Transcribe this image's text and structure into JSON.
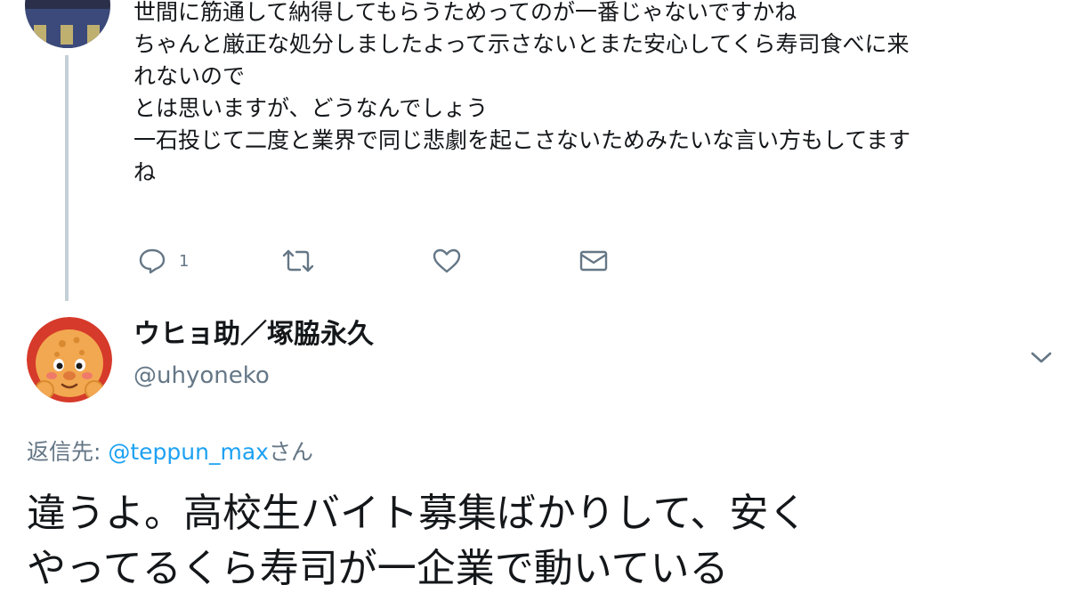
{
  "previous_tweet": {
    "lines": [
      "世間に筋通して納得してもらうためってのが一番じゃないですかね",
      "ちゃんと厳正な処分しましたよって示さないとまた安心してくら寿司食べに来",
      "れないので",
      "とは思いますが、どうなんでしょう",
      "一石投じて二度と業界で同じ悲劇を起こさないためみたいな言い方もしてます",
      "ね"
    ],
    "actions": {
      "reply_icon": "reply-icon",
      "reply_count": "1",
      "retweet_icon": "retweet-icon",
      "like_icon": "heart-icon",
      "dm_icon": "envelope-icon"
    }
  },
  "tweet": {
    "display_name": "ウヒョ助／塚脇永久",
    "handle": "@uhyoneko",
    "menu_icon": "chevron-down-icon",
    "reply_label": "返信先: ",
    "reply_mention": "@teppun_max",
    "reply_suffix": "さん",
    "text_lines": [
      "違うよ。高校生バイト募集ばかりして、安く",
      "やってるくら寿司が一企業で動いている"
    ]
  },
  "colors": {
    "text": "#14171a",
    "secondary": "#657786",
    "link": "#1da1f2",
    "thread_line": "#c4cfd6"
  }
}
